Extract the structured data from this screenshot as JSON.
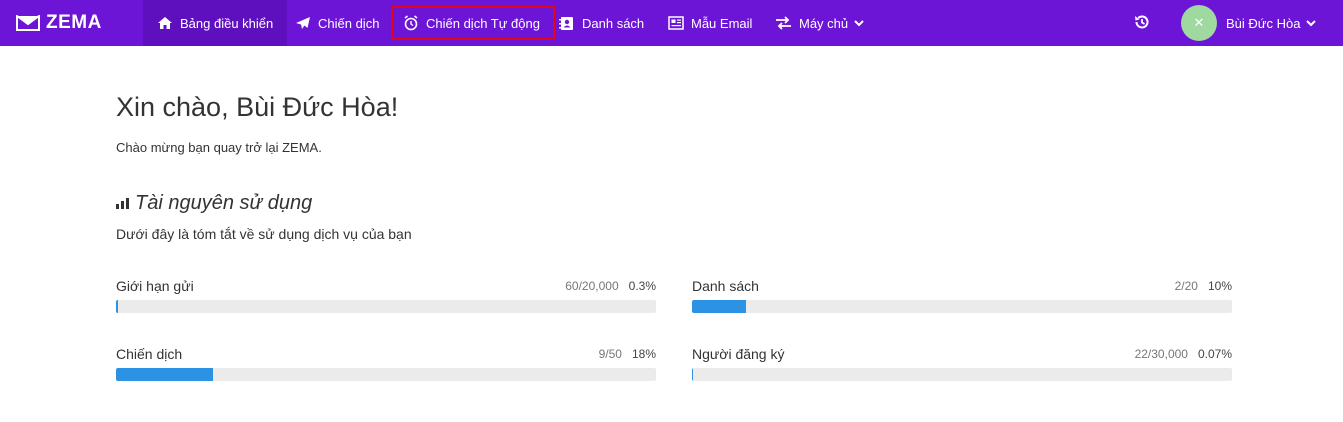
{
  "app": {
    "name": "ZEMA"
  },
  "nav": {
    "items": [
      {
        "label": "Bảng điều khiển",
        "icon": "home-icon"
      },
      {
        "label": "Chiến dịch",
        "icon": "paper-plane-icon"
      },
      {
        "label": "Chiến dịch Tự động",
        "icon": "alarm-clock-icon"
      },
      {
        "label": "Danh sách",
        "icon": "contact-book-icon"
      },
      {
        "label": "Mẫu Email",
        "icon": "newspaper-icon"
      },
      {
        "label": "Máy chủ",
        "icon": "exchange-icon"
      }
    ]
  },
  "user": {
    "name": "Bùi Đức Hòa",
    "avatar_initial": "✕"
  },
  "greeting": {
    "title": "Xin chào, Bùi Đức Hòa!",
    "subtitle": "Chào mừng bạn quay trở lại ZEMA."
  },
  "resources": {
    "title": "Tài nguyên sử dụng",
    "description": "Dưới đây là tóm tắt về sử dụng dịch vụ của bạn",
    "stats": [
      {
        "label": "Giới hạn gửi",
        "count": "60/20,000",
        "percent": "0.3%",
        "fill_pct": 0.3
      },
      {
        "label": "Danh sách",
        "count": "2/20",
        "percent": "10%",
        "fill_pct": 10
      },
      {
        "label": "Chiến dịch",
        "count": "9/50",
        "percent": "18%",
        "fill_pct": 18
      },
      {
        "label": "Người đăng ký",
        "count": "22/30,000",
        "percent": "0.07%",
        "fill_pct": 0.07
      }
    ]
  },
  "colors": {
    "topbar": "#6c15d6",
    "progress": "#2c93e4",
    "highlight": "#e0061a"
  }
}
